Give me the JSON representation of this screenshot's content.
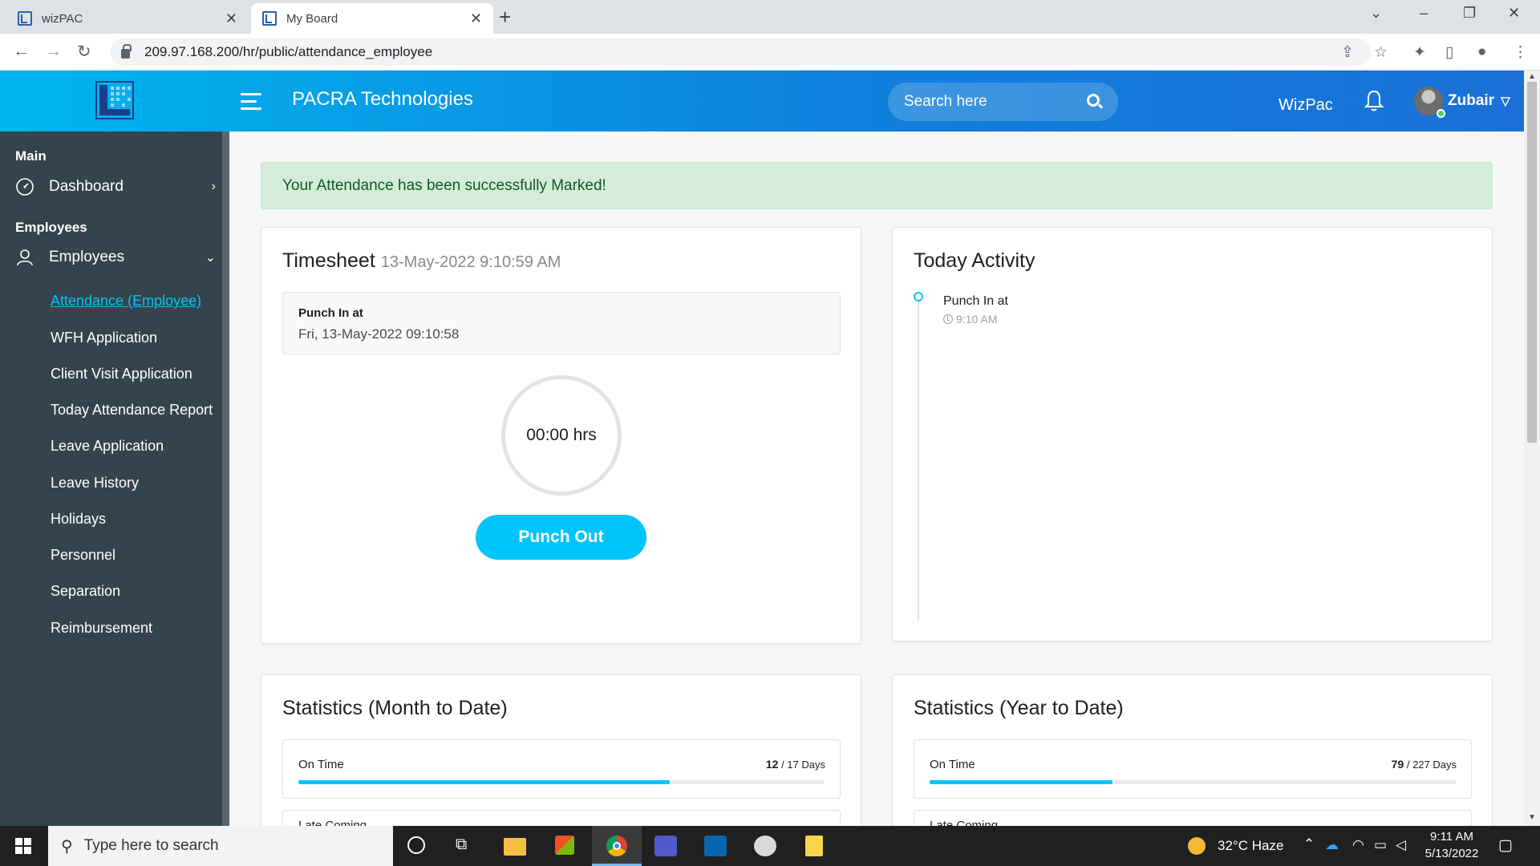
{
  "browser": {
    "tabs": [
      {
        "title": "wizPAC",
        "active": false
      },
      {
        "title": "My Board",
        "active": true
      }
    ],
    "url": "209.97.168.200/hr/public/attendance_employee"
  },
  "header": {
    "company": "PACRA Technologies",
    "search_placeholder": "Search here",
    "app_link": "WizPac",
    "user_name": "Zubair"
  },
  "sidebar": {
    "section_main": "Main",
    "dashboard": "Dashboard",
    "section_employees": "Employees",
    "employees": "Employees",
    "sub_items": [
      "Attendance (Employee)",
      "WFH Application",
      "Client Visit Application",
      "Today Attendance Report",
      "Leave Application",
      "Leave History",
      "Holidays",
      "Personnel",
      "Separation",
      "Reimbursement"
    ]
  },
  "alert": "Your Attendance has been successfully Marked!",
  "timesheet": {
    "title": "Timesheet",
    "datetime": "13-May-2022 9:10:59 AM",
    "punch_label": "Punch In at",
    "punch_value": "Fri, 13-May-2022 09:10:58",
    "hours": "00:00 hrs",
    "button": "Punch Out"
  },
  "activity": {
    "title": "Today Activity",
    "items": [
      {
        "label": "Punch In at",
        "time": "9:10 AM"
      }
    ]
  },
  "stats_month": {
    "title": "Statistics (Month to Date)",
    "on_time_label": "On Time",
    "on_time_value": "12",
    "on_time_total": "/ 17 Days",
    "on_time_fraction": 0.706,
    "next_label": "Late Coming"
  },
  "stats_year": {
    "title": "Statistics (Year to Date)",
    "on_time_label": "On Time",
    "on_time_value": "79",
    "on_time_total": "/ 227 Days",
    "on_time_fraction": 0.348,
    "next_label": "Late Coming"
  },
  "taskbar": {
    "search_placeholder": "Type here to search",
    "weather": "32°C  Haze",
    "time": "9:11 AM",
    "date": "5/13/2022"
  },
  "colors": {
    "accent": "#00c5fb",
    "sidebar": "#34444c",
    "alert_bg": "#d4edda"
  }
}
